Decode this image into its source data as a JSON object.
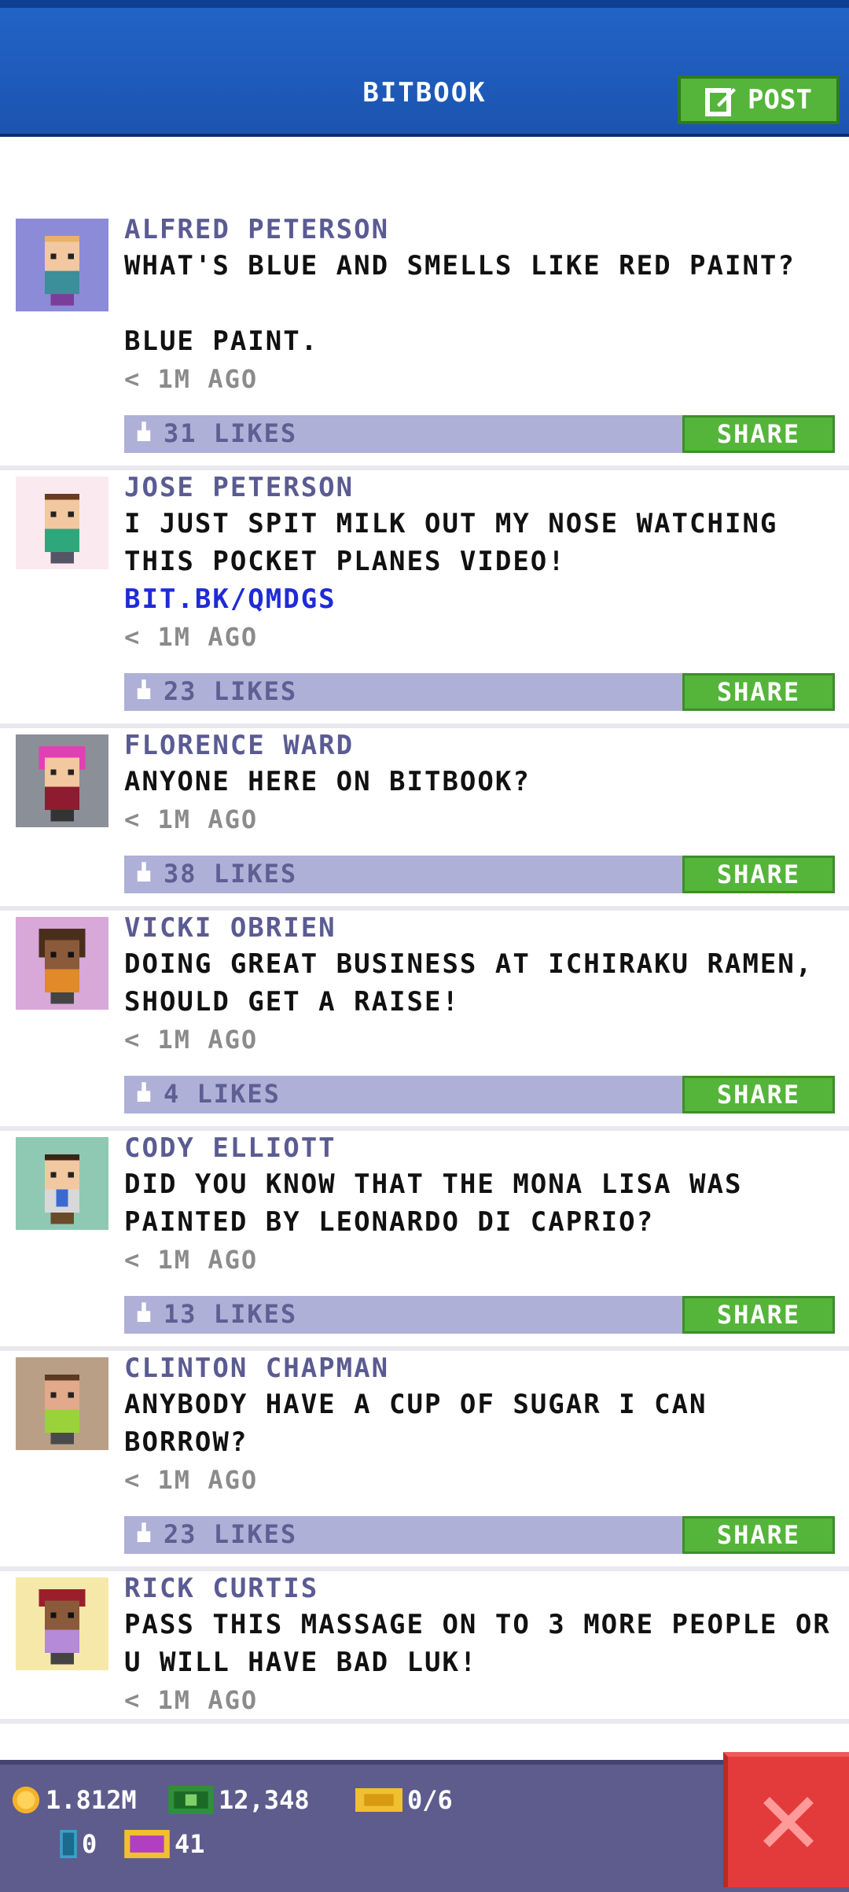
{
  "header": {
    "title": "BITBOOK",
    "post_label": "POST"
  },
  "posts": [
    {
      "author": "ALFRED PETERSON",
      "message": "WHAT'S BLUE AND SMELLS LIKE RED PAINT?\n\nBLUE PAINT.",
      "link": "",
      "time": "< 1M AGO",
      "likes": "31 LIKES",
      "share": "SHARE",
      "avatar_bg": "#8c8bd8"
    },
    {
      "author": "JOSE PETERSON",
      "message": "I JUST SPIT MILK OUT MY NOSE WATCHING THIS POCKET PLANES VIDEO!",
      "link": "BIT.BK/QMDGS",
      "time": "< 1M AGO",
      "likes": "23 LIKES",
      "share": "SHARE",
      "avatar_bg": "#fbe9f0"
    },
    {
      "author": "FLORENCE WARD",
      "message": "ANYONE HERE ON BITBOOK?",
      "link": "",
      "time": "< 1M AGO",
      "likes": "38 LIKES",
      "share": "SHARE",
      "avatar_bg": "#8b8f98"
    },
    {
      "author": "VICKI OBRIEN",
      "message": "DOING GREAT BUSINESS AT ICHIRAKU RAMEN, SHOULD GET A RAISE!",
      "link": "",
      "time": "< 1M AGO",
      "likes": "4 LIKES",
      "share": "SHARE",
      "avatar_bg": "#d8a8d8"
    },
    {
      "author": "CODY ELLIOTT",
      "message": "DID YOU KNOW THAT THE MONA LISA WAS PAINTED BY LEONARDO DI CAPRIO?",
      "link": "",
      "time": "< 1M AGO",
      "likes": "13 LIKES",
      "share": "SHARE",
      "avatar_bg": "#8fc9b4"
    },
    {
      "author": "CLINTON CHAPMAN",
      "message": "ANYBODY HAVE A CUP OF SUGAR I CAN BORROW?",
      "link": "",
      "time": "< 1M AGO",
      "likes": "23 LIKES",
      "share": "SHARE",
      "avatar_bg": "#b99f86"
    },
    {
      "author": "RICK CURTIS",
      "message": "PASS THIS MASSAGE ON TO 3 MORE PEOPLE OR U WILL HAVE BAD LUK!",
      "link": "",
      "time": "< 1M AGO",
      "likes": "",
      "share": "",
      "avatar_bg": "#f6e8a8"
    }
  ],
  "bottom": {
    "coins": "1.812M",
    "bux": "12,348",
    "tickets": "0/6",
    "items": "0",
    "vip": "41"
  },
  "colors": {
    "header": "#1c54b0",
    "share_green": "#55b43a",
    "likes_bar": "#aeb0d8",
    "close_red": "#e33b3b"
  }
}
